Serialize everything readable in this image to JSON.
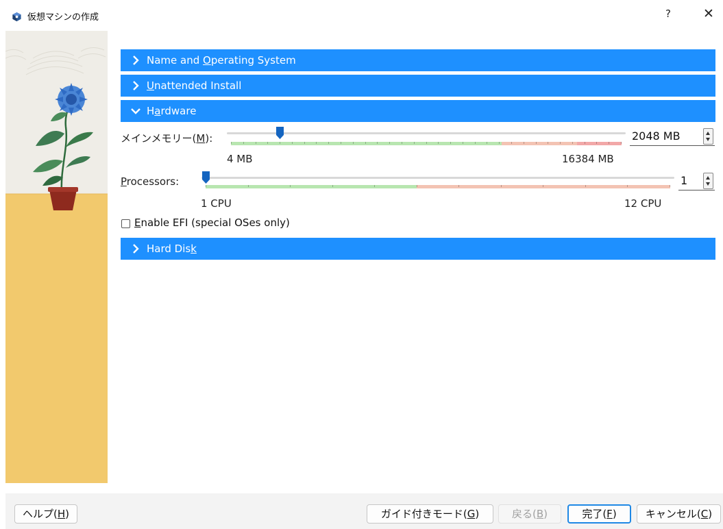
{
  "window": {
    "title": "仮想マシンの作成",
    "help_glyph": "?",
    "close_glyph": "✕",
    "icon": "virtualbox-cube-icon"
  },
  "sections": {
    "name_os": {
      "label_pre": "Name and ",
      "label_mnemonic": "O",
      "label_post": "perating System",
      "expanded": false
    },
    "unattended": {
      "label_pre": "",
      "label_mnemonic": "U",
      "label_post": "nattended Install",
      "expanded": false
    },
    "hardware": {
      "label_pre": "H",
      "label_mnemonic": "a",
      "label_post": "rdware",
      "expanded": true
    },
    "hard_disk": {
      "label_pre": "Hard Dis",
      "label_mnemonic": "k",
      "label_post": "",
      "expanded": false
    }
  },
  "memory": {
    "label_pre": "メインメモリー(",
    "label_mnemonic": "M",
    "label_post": "):",
    "value": "2048 MB",
    "min_label": "4 MB",
    "max_label": "16384 MB",
    "level_fraction": 0.125
  },
  "processors": {
    "label_pre": "",
    "label_mnemonic": "P",
    "label_post": "rocessors:",
    "value": "1",
    "min_label": "1 CPU",
    "max_label": "12 CPU",
    "level_fraction": 0.0
  },
  "efi": {
    "label_pre": "",
    "label_mnemonic": "E",
    "label_post": "nable EFI (special OSes only)",
    "checked": false
  },
  "footer": {
    "help": {
      "pre": "ヘルプ(",
      "mn": "H",
      "post": ")"
    },
    "guided": {
      "pre": "ガイド付きモード(",
      "mn": "G",
      "post": ")"
    },
    "back": {
      "pre": "戻る(",
      "mn": "B",
      "post": ")"
    },
    "finish": {
      "pre": "完了(",
      "mn": "F",
      "post": ")"
    },
    "cancel": {
      "pre": "キャンセル(",
      "mn": "C",
      "post": ")"
    }
  },
  "colors": {
    "section_header": "#1e90ff",
    "scale_green": "#b8e6b0",
    "scale_orange": "#f3c3b3",
    "scale_red": "#f2a8a8",
    "slider_handle": "#1565c0",
    "side_yellow": "#f2c96d"
  }
}
